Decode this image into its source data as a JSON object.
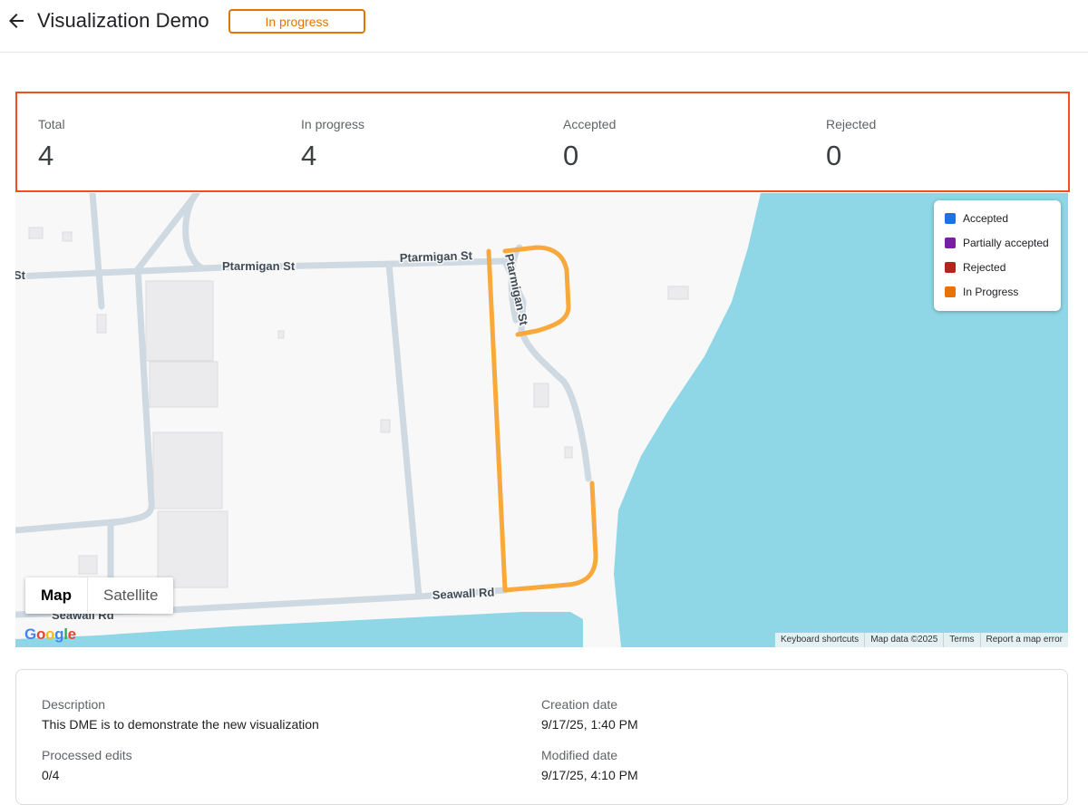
{
  "header": {
    "title": "Visualization Demo",
    "status": "In progress",
    "back_icon": "arrow-back-icon",
    "status_color": "#e37400"
  },
  "stats": [
    {
      "label": "Total",
      "value": "4"
    },
    {
      "label": "In progress",
      "value": "4"
    },
    {
      "label": "Accepted",
      "value": "0"
    },
    {
      "label": "Rejected",
      "value": "0"
    }
  ],
  "map": {
    "streets": {
      "ptarmigan_west": "Ptarmigan St",
      "ptarmigan_east": "Ptarmigan St",
      "ptarmigan_loop": "Ptarmigan St",
      "seawall_main": "Seawall Rd",
      "seawall_partial": "Seawall Rd",
      "edge_st": "St"
    },
    "legend": [
      {
        "label": "Accepted",
        "color": "#1a73e8"
      },
      {
        "label": "Partially accepted",
        "color": "#7b1fa2"
      },
      {
        "label": "Rejected",
        "color": "#b3261e"
      },
      {
        "label": "In Progress",
        "color": "#e8710a"
      }
    ],
    "map_type": {
      "map": "Map",
      "satellite": "Satellite"
    },
    "logo": "Google",
    "attribution": [
      "Keyboard shortcuts",
      "Map data ©2025",
      "Terms",
      "Report a map error"
    ],
    "colors": {
      "water": "#8fd6e6",
      "road": "#cfd9e1",
      "highlight": "#f9a93b",
      "land": "#f8f8f8"
    }
  },
  "details": {
    "description_label": "Description",
    "description_value": "This DME is to demonstrate the new visualization",
    "processed_label": "Processed edits",
    "processed_value": "0/4",
    "creation_label": "Creation date",
    "creation_value": "9/17/25, 1:40 PM",
    "modified_label": "Modified date",
    "modified_value": "9/17/25, 4:10 PM"
  }
}
